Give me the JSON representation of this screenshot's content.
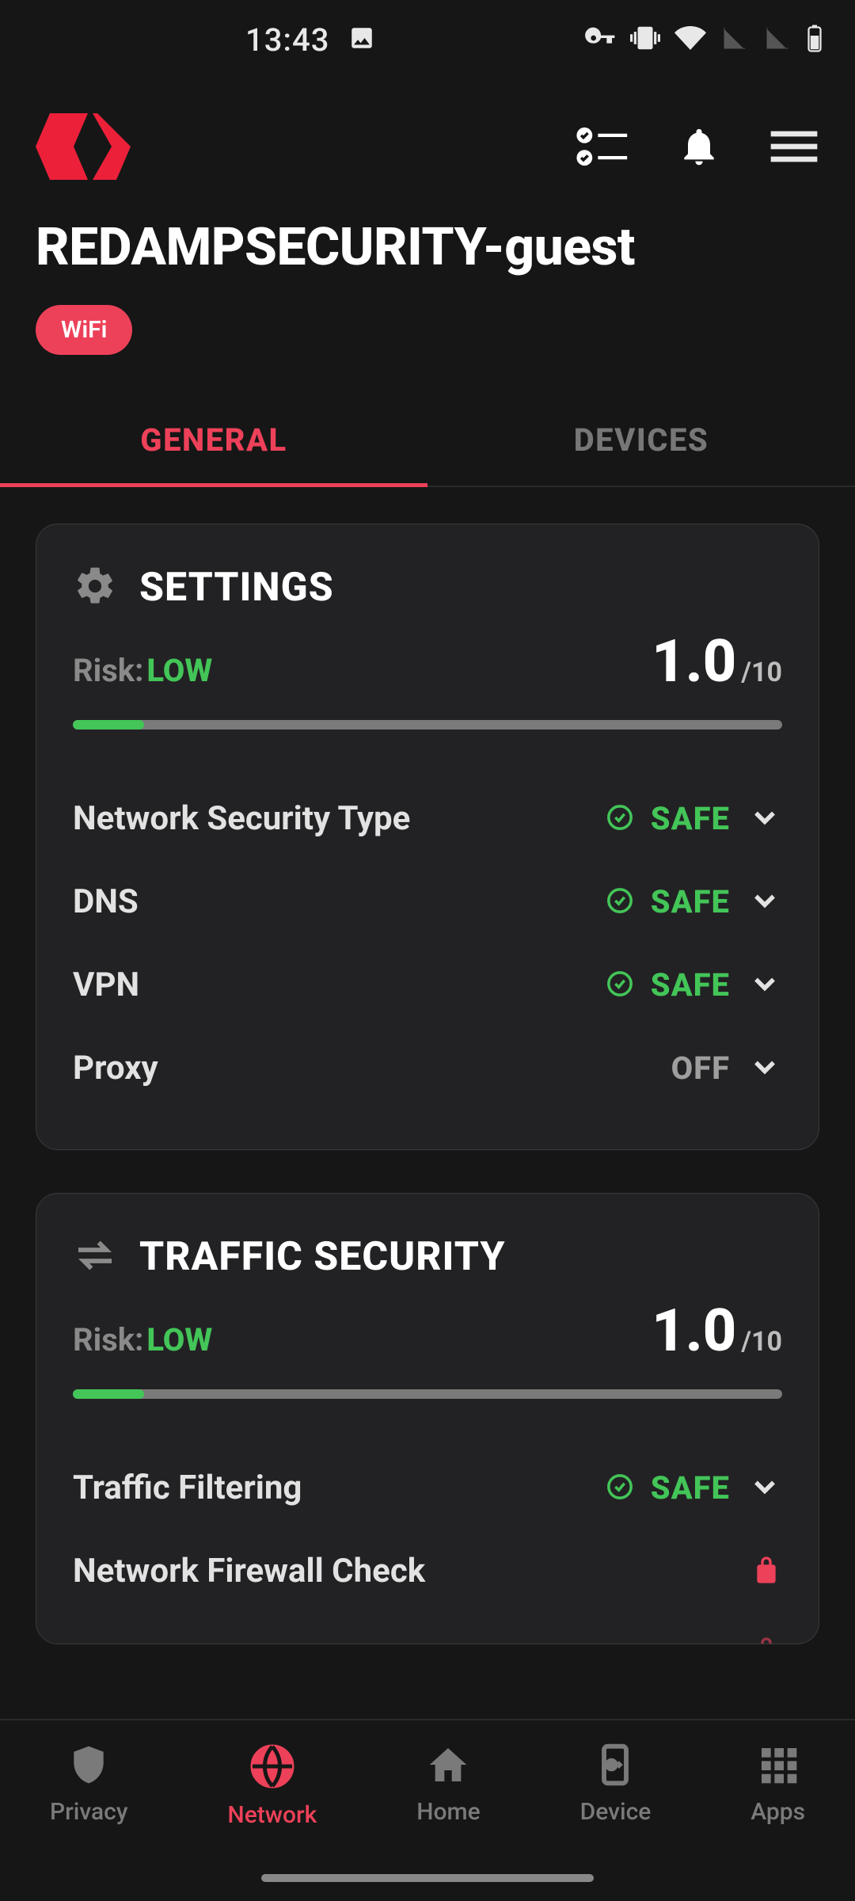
{
  "statusbar": {
    "time": "13:43"
  },
  "header": {
    "network_name": "REDAMPSECURITY-guest",
    "badge": "WiFi"
  },
  "tabs": {
    "general": "GENERAL",
    "devices": "DEVICES",
    "active": "general"
  },
  "cards": {
    "settings": {
      "title": "SETTINGS",
      "risk_label": "Risk:",
      "risk_value": "LOW",
      "score": "1.0",
      "score_max": "/10",
      "progress_percent": 10,
      "items": [
        {
          "label": "Network Security Type",
          "status": "SAFE",
          "kind": "safe"
        },
        {
          "label": "DNS",
          "status": "SAFE",
          "kind": "safe"
        },
        {
          "label": "VPN",
          "status": "SAFE",
          "kind": "safe"
        },
        {
          "label": "Proxy",
          "status": "OFF",
          "kind": "off"
        }
      ]
    },
    "traffic": {
      "title": "TRAFFIC SECURITY",
      "risk_label": "Risk:",
      "risk_value": "LOW",
      "score": "1.0",
      "score_max": "/10",
      "progress_percent": 10,
      "items": [
        {
          "label": "Traffic Filtering",
          "status": "SAFE",
          "kind": "safe"
        },
        {
          "label": "Network Firewall Check",
          "status": "",
          "kind": "locked"
        }
      ]
    }
  },
  "bottomnav": {
    "privacy": "Privacy",
    "network": "Network",
    "home": "Home",
    "device": "Device",
    "apps": "Apps",
    "active": "network"
  }
}
